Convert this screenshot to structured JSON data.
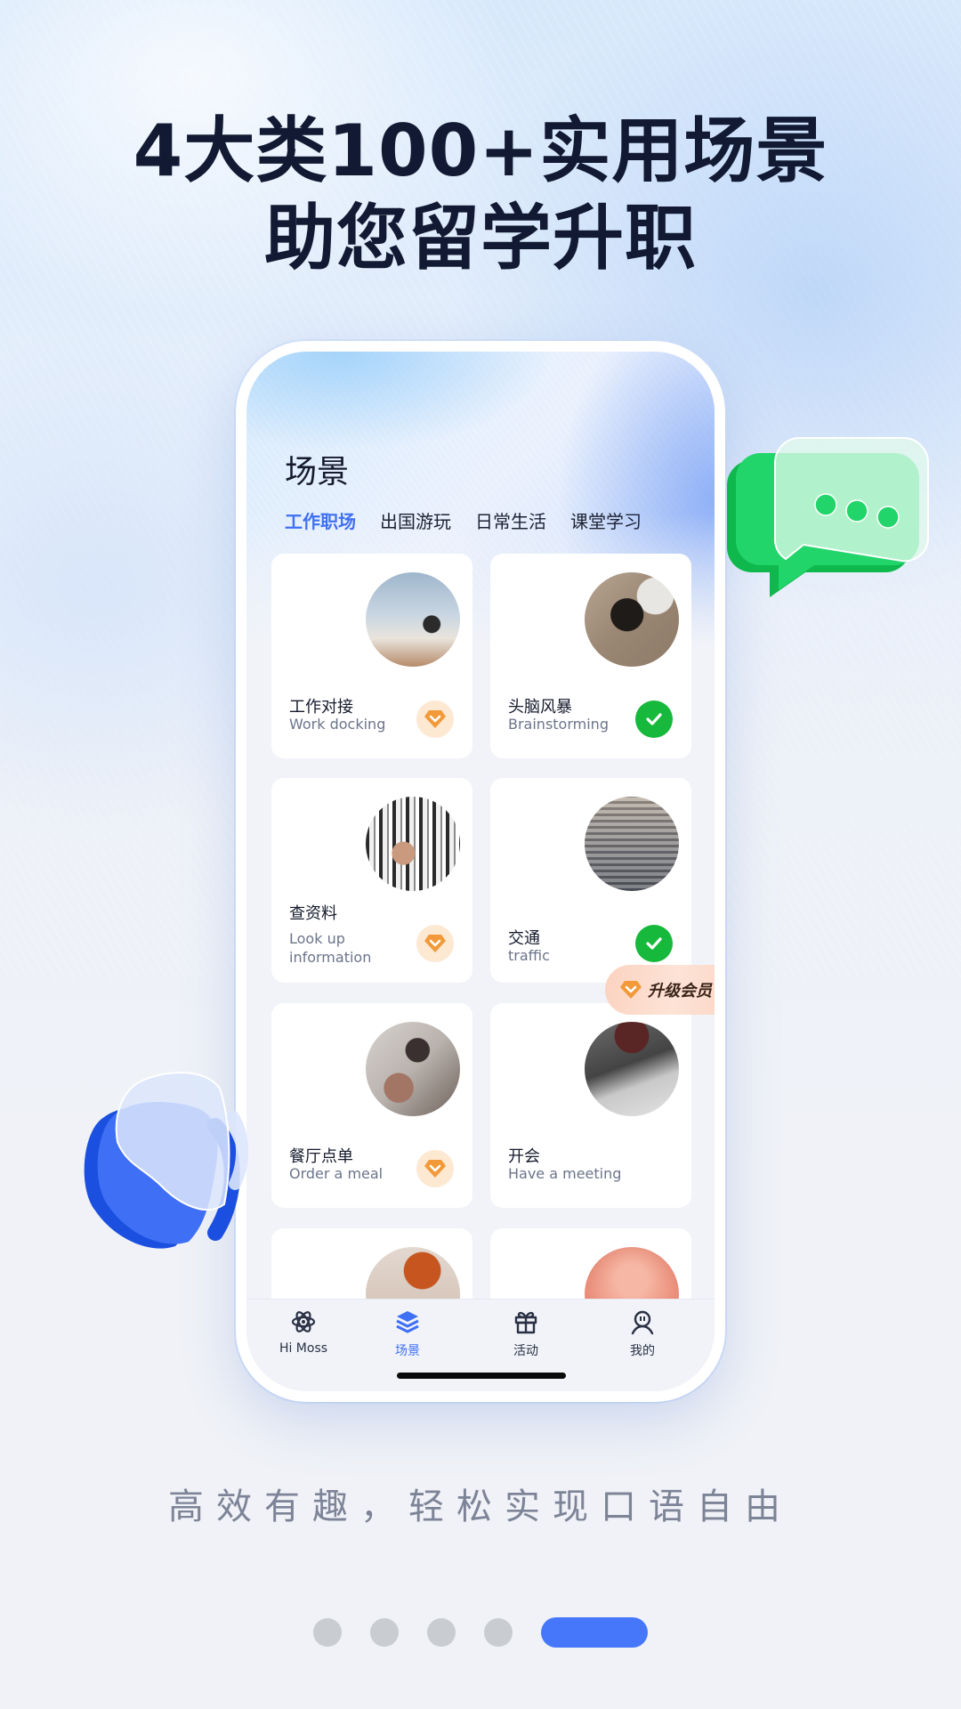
{
  "headline": {
    "line1": "4大类100+实用场景",
    "line2": "助您留学升职"
  },
  "app": {
    "title": "场景",
    "categories": [
      {
        "label": "工作职场",
        "active": true
      },
      {
        "label": "出国游玩",
        "active": false
      },
      {
        "label": "日常生活",
        "active": false
      },
      {
        "label": "课堂学习",
        "active": false
      }
    ],
    "scenes": [
      {
        "cn": "工作对接",
        "en": "Work docking",
        "status": "vip",
        "status_icon": "diamond-icon",
        "photo": "laptop-coffee-photo"
      },
      {
        "cn": "头脑风暴",
        "en": "Brainstorming",
        "status": "done",
        "status_icon": "check-icon",
        "photo": "woman-at-desk-photo"
      },
      {
        "cn": "查资料",
        "en": "Look up information",
        "status": "vip",
        "status_icon": "diamond-icon",
        "photo": "bookshelf-hand-photo"
      },
      {
        "cn": "交通",
        "en": "traffic",
        "status": "done",
        "status_icon": "check-icon",
        "photo": "city-traffic-photo"
      },
      {
        "cn": "餐厅点单",
        "en": "Order a meal",
        "status": "vip",
        "status_icon": "diamond-icon",
        "photo": "menu-hands-photo"
      },
      {
        "cn": "开会",
        "en": "Have a meeting",
        "status": "none",
        "status_icon": "",
        "photo": "meeting-laptops-photo"
      },
      {
        "cn": "",
        "en": "",
        "status": "none",
        "status_icon": "",
        "photo": "basketball-hoop-photo"
      },
      {
        "cn": "",
        "en": "",
        "status": "none",
        "status_icon": "",
        "photo": "concert-hands-photo"
      }
    ],
    "upgrade_badge": "升级会员",
    "tabbar": [
      {
        "label": "Hi Moss",
        "icon": "atom-icon",
        "active": false
      },
      {
        "label": "场景",
        "icon": "layers-icon",
        "active": true
      },
      {
        "label": "活动",
        "icon": "gift-icon",
        "active": false
      },
      {
        "label": "我的",
        "icon": "profile-icon",
        "active": false
      }
    ]
  },
  "subtitle": "高效有趣，轻松实现口语自由",
  "pager": {
    "count": 5,
    "active_index": 4
  },
  "colors": {
    "accent": "#3f6ff4",
    "pager_active": "#4677fb",
    "pager_inactive": "#c9ccd1",
    "check_green": "#16b93b",
    "vip_orange": "#f29a3a",
    "headline": "#121a33"
  }
}
